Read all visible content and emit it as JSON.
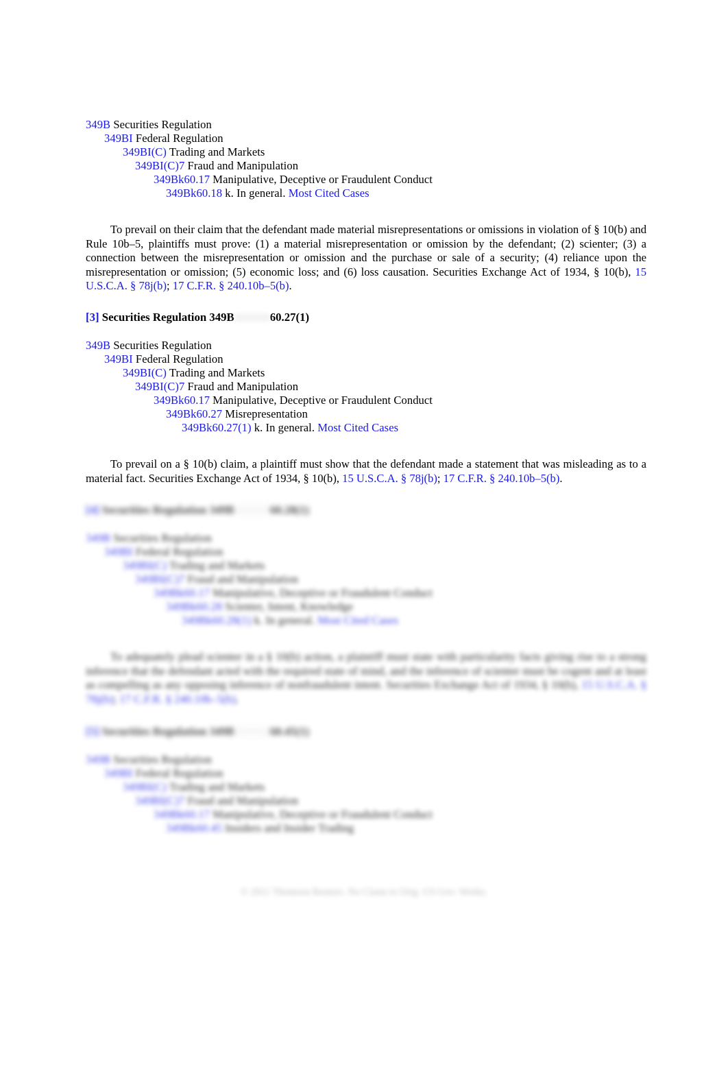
{
  "document": {
    "background_color": "#ffffff",
    "link_color": "#1a1ae6",
    "text_color": "#000000"
  },
  "sections": {
    "block1": {
      "lines": [
        {
          "number": "349B",
          "text": " Securities Regulation"
        },
        {
          "number": "349BI",
          "text": " Federal Regulation"
        },
        {
          "number": "349BI(C)",
          "text": " Trading and Markets"
        },
        {
          "number": "349BI(C)7",
          "text": " Fraud and Manipulation"
        },
        {
          "number": "349Bk60.17",
          "text": " Manipulative, Deceptive or Fraudulent Conduct"
        },
        {
          "number": "349Bk60.18",
          "text": " k. In general. ",
          "link": "Most Cited Cases"
        }
      ]
    },
    "para1": {
      "lead": "To prevail on their claim that the defendant made material misrepresentations or omissions in violation of § 10(b) and Rule 10b–5, plaintiffs must prove: (1) a material misrepresentation or omission by the defendant; (2) scienter; (3) a connection between the misrepresentation or omission and the purchase or sale of a security; (4) reliance upon the misrepresentation or omission; (5) economic loss; and (6) loss causation. Securities Exchange Act of 1934, § 10(b), ",
      "cite1": "15 U.S.C.A. § 78j(b)",
      "sep": "; ",
      "cite2": "17 C.F.R. § 240.10b–5(b)",
      "tail": "."
    },
    "heading3": {
      "bracket": "[3]",
      "title": " Securities Regulation 349B",
      "keynumber": "60.27(1)"
    },
    "block2": {
      "lines": [
        {
          "number": "349B",
          "text": " Securities Regulation"
        },
        {
          "number": "349BI",
          "text": " Federal Regulation"
        },
        {
          "number": "349BI(C)",
          "text": " Trading and Markets"
        },
        {
          "number": "349BI(C)7",
          "text": " Fraud and Manipulation"
        },
        {
          "number": "349Bk60.17",
          "text": " Manipulative, Deceptive or Fraudulent Conduct"
        },
        {
          "number": "349Bk60.27",
          "text": " Misrepresentation"
        },
        {
          "number": "349Bk60.27(1)",
          "text": " k. In general. ",
          "link": "Most Cited Cases"
        }
      ]
    },
    "para2": {
      "lead": "To prevail on a § 10(b) claim, a plaintiff must show that the defendant made a statement that was misleading as to a material fact. Securities Exchange Act of 1934, § 10(b), ",
      "cite1": "15 U.S.C.A. § 78j(b)",
      "sep": "; ",
      "cite2": "17 C.F.R. § 240.10b–5(b)",
      "tail": "."
    },
    "heading4": {
      "bracket": "[4]",
      "title": " Securities Regulation 349B",
      "keynumber": "60.28(1)"
    },
    "block3": {
      "lines": [
        {
          "number": "349B",
          "text": " Securities Regulation"
        },
        {
          "number": "349BI",
          "text": " Federal Regulation"
        },
        {
          "number": "349BI(C)",
          "text": " Trading and Markets"
        },
        {
          "number": "349BI(C)7",
          "text": " Fraud and Manipulation"
        },
        {
          "number": "349Bk60.17",
          "text": " Manipulative, Deceptive or Fraudulent Conduct"
        },
        {
          "number": "349Bk60.28",
          "text": " Scienter, Intent, Knowledge"
        },
        {
          "number": "349Bk60.28(1)",
          "text": " k. In general. ",
          "link": "Most Cited Cases"
        }
      ]
    },
    "para3": {
      "lead": "To adequately plead scienter in a § 10(b) action, a plaintiff must state with particularity facts giving rise to a strong inference that the defendant acted with the required state of mind, and the inference of scienter must be cogent and at least as compelling as any opposing inference of nonfraudulent intent. Securities Exchange Act of 1934, § 10(b), ",
      "cite1": "15 U.S.C.A. § 78j(b)",
      "sep": "; ",
      "cite2": "17 C.F.R. § 240.10b–5(b)",
      "tail": "."
    },
    "heading5": {
      "bracket": "[5]",
      "title": " Securities Regulation 349B",
      "keynumber": "60.45(1)"
    },
    "block4": {
      "lines": [
        {
          "number": "349B",
          "text": " Securities Regulation"
        },
        {
          "number": "349BI",
          "text": " Federal Regulation"
        },
        {
          "number": "349BI(C)",
          "text": " Trading and Markets"
        },
        {
          "number": "349BI(C)7",
          "text": " Fraud and Manipulation"
        },
        {
          "number": "349Bk60.17",
          "text": " Manipulative, Deceptive or Fraudulent Conduct"
        },
        {
          "number": "349Bk60.45",
          "text": " Insiders and Insider Trading"
        }
      ]
    }
  },
  "footer": {
    "text": "© 2011 Thomson Reuters. No Claim to Orig. US Gov. Works."
  }
}
